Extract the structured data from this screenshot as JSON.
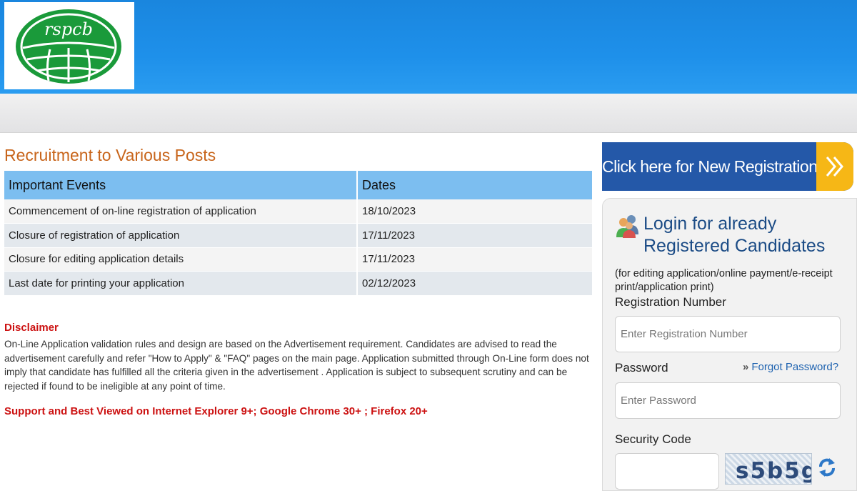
{
  "header": {
    "logo_text": "rspcb",
    "colors": {
      "header_blue": "#1e90ea",
      "subbar": "#e6e6e8"
    }
  },
  "main": {
    "title": "Recruitment to Various Posts",
    "table": {
      "headers": [
        "Important Events",
        "Dates"
      ],
      "rows": [
        {
          "event": "Commencement of on-line registration of application",
          "date": "18/10/2023"
        },
        {
          "event": "Closure of registration of application",
          "date": "17/11/2023"
        },
        {
          "event": "Closure for editing application details",
          "date": "17/11/2023"
        },
        {
          "event": "Last date for printing your application",
          "date": "02/12/2023"
        }
      ]
    },
    "disclaimer_title": "Disclaimer",
    "disclaimer_text": "On-Line Application validation rules and design are based on the Advertisement requirement. Candidates are advised to read the advertisement carefully and refer \"How to Apply\" & \"FAQ\" pages on the main page. Application submitted through On-Line form does not imply that candidate has fulfilled all the criteria given in the advertisement . Application is subject to subsequent scrutiny and can be rejected if found to be ineligible at any point of time.",
    "support_text": "Support and Best Viewed on Internet Explorer 9+; Google Chrome 30+ ; Firefox 20+"
  },
  "sidebar": {
    "new_registration_label": "Click here for New Registration",
    "login": {
      "title": "Login for already Registered Candidates",
      "subtitle": "(for editing application/online payment/e-receipt print/application print)",
      "registration_label": "Registration Number",
      "registration_placeholder": "Enter Registration Number",
      "password_label": "Password",
      "forgot_password": "Forgot Password?",
      "password_placeholder": "Enter Password",
      "security_label": "Security Code",
      "captcha_text": "s5b5g"
    },
    "colors": {
      "button_blue": "#2458a8",
      "button_arrow": "#f6b716",
      "title_orange": "#c8651b",
      "alert_red": "#cc1111"
    }
  },
  "icons": [
    "users-icon",
    "double-chevron-right-icon",
    "refresh-icon"
  ]
}
